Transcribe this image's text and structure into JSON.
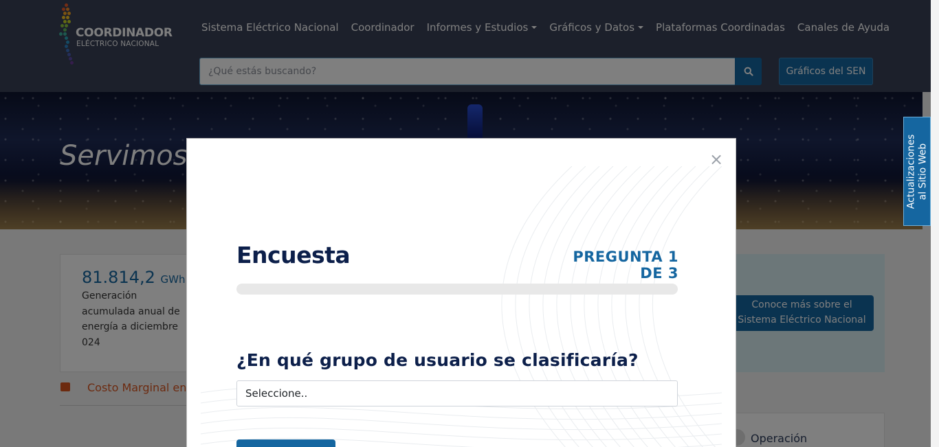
{
  "header": {
    "logo": {
      "title": "COORDINADOR",
      "subtitle": "ELÉCTRICO NACIONAL"
    },
    "nav": [
      {
        "label": "Sistema Eléctrico Nacional",
        "dropdown": false
      },
      {
        "label": "Coordinador",
        "dropdown": false
      },
      {
        "label": "Informes y Estudios",
        "dropdown": true
      },
      {
        "label": "Gráficos y Datos",
        "dropdown": true
      },
      {
        "label": "Plataformas Coordinadas",
        "dropdown": false
      },
      {
        "label": "Canales de Ayuda",
        "dropdown": false
      }
    ],
    "search": {
      "placeholder": "¿Qué estás buscando?",
      "icon": "search-icon"
    },
    "sen_button": "Gráficos del SEN"
  },
  "hero": {
    "text": "Servimos"
  },
  "side_tab": {
    "line1": "Actualizaciones",
    "line2": "al Sitio Web"
  },
  "stats": {
    "value": "81.814,2",
    "unit": "GWh",
    "description": "Generación acumulada anual de energía a diciembre 024"
  },
  "more_button": {
    "line1": "Conoce más sobre el",
    "line2": "Sistema Eléctrico Nacional"
  },
  "costo_link": "Costo Marginal en L",
  "operacion": "Operación",
  "modal": {
    "title": "Encuesta",
    "counter": "PREGUNTA 1 DE 3",
    "progress": 0,
    "question": "¿En qué grupo de usuario se clasificaría?",
    "select_value": "Seleccione..",
    "close": "×"
  },
  "colors": {
    "primary": "#1566a0",
    "header_bg": "#394157",
    "title": "#0c1f4a",
    "accent_orange": "#d9541e"
  }
}
